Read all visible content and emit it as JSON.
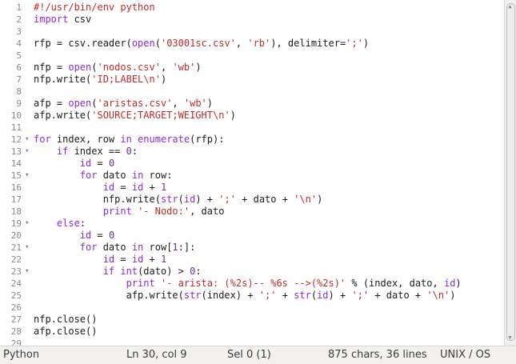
{
  "editor": {
    "lines": [
      {
        "n": "1",
        "fold": "",
        "html": "<span class=\"st\">#!/usr/bin/env python</span>"
      },
      {
        "n": "2",
        "fold": "",
        "html": "<span class=\"kw\">import</span> csv"
      },
      {
        "n": "3",
        "fold": "",
        "html": ""
      },
      {
        "n": "4",
        "fold": "",
        "html": "rfp = csv.reader(<span class=\"kw\">open</span>(<span class=\"st\">'03001sc.csv'</span>, <span class=\"st\">'rb'</span>), delimiter=<span class=\"st\">';'</span>)"
      },
      {
        "n": "5",
        "fold": "",
        "html": ""
      },
      {
        "n": "6",
        "fold": "",
        "html": "nfp = <span class=\"kw\">open</span>(<span class=\"st\">'nodos.csv'</span>, <span class=\"st\">'wb'</span>)"
      },
      {
        "n": "7",
        "fold": "",
        "html": "nfp.write(<span class=\"st\">'ID;LABEL\\n'</span>)"
      },
      {
        "n": "8",
        "fold": "",
        "html": ""
      },
      {
        "n": "9",
        "fold": "",
        "html": "afp = <span class=\"kw\">open</span>(<span class=\"st\">'aristas.csv'</span>, <span class=\"st\">'wb'</span>)"
      },
      {
        "n": "10",
        "fold": "",
        "html": "afp.write(<span class=\"st\">'SOURCE;TARGET;WEIGHT\\n'</span>)"
      },
      {
        "n": "11",
        "fold": "",
        "html": ""
      },
      {
        "n": "12",
        "fold": "▾",
        "html": "<span class=\"kw\">for</span> index, row <span class=\"kw\">in</span> <span class=\"kw\">enumerate</span>(rfp):"
      },
      {
        "n": "13",
        "fold": "▾",
        "html": "    <span class=\"kw\">if</span> index == <span class=\"nu\">0</span>:"
      },
      {
        "n": "14",
        "fold": "",
        "html": "        <span class=\"kw\">id</span> = <span class=\"nu\">0</span>"
      },
      {
        "n": "15",
        "fold": "▾",
        "html": "        <span class=\"kw\">for</span> dato <span class=\"kw\">in</span> row:"
      },
      {
        "n": "16",
        "fold": "",
        "html": "            <span class=\"kw\">id</span> = <span class=\"kw\">id</span> + <span class=\"nu\">1</span>"
      },
      {
        "n": "17",
        "fold": "",
        "html": "            nfp.write(<span class=\"kw\">str</span>(<span class=\"kw\">id</span>) + <span class=\"st\">';'</span> + dato + <span class=\"st\">'\\n'</span>)"
      },
      {
        "n": "18",
        "fold": "",
        "html": "            <span class=\"kw\">print</span> <span class=\"st\">'- Nodo:'</span>, dato"
      },
      {
        "n": "19",
        "fold": "▾",
        "html": "    <span class=\"kw\">else</span>:"
      },
      {
        "n": "20",
        "fold": "",
        "html": "        <span class=\"kw\">id</span> = <span class=\"nu\">0</span>"
      },
      {
        "n": "21",
        "fold": "▾",
        "html": "        <span class=\"kw\">for</span> dato <span class=\"kw\">in</span> row[<span class=\"nu\">1</span>:]:"
      },
      {
        "n": "22",
        "fold": "",
        "html": "            <span class=\"kw\">id</span> = <span class=\"kw\">id</span> + <span class=\"nu\">1</span>"
      },
      {
        "n": "23",
        "fold": "▾",
        "html": "            <span class=\"kw\">if</span> <span class=\"kw\">int</span>(dato) > <span class=\"nu\">0</span>:"
      },
      {
        "n": "24",
        "fold": "",
        "html": "                <span class=\"kw\">print</span> <span class=\"st\">'- arista: (%2s)-- %6s -->(%2s)'</span> % (index, dato, <span class=\"kw\">id</span>)"
      },
      {
        "n": "25",
        "fold": "",
        "html": "                afp.write(<span class=\"kw\">str</span>(index) + <span class=\"st\">';'</span> + <span class=\"kw\">str</span>(<span class=\"kw\">id</span>) + <span class=\"st\">';'</span> + dato + <span class=\"st\">'\\n'</span>)"
      },
      {
        "n": "26",
        "fold": "",
        "html": ""
      },
      {
        "n": "27",
        "fold": "",
        "html": "nfp.close()"
      },
      {
        "n": "28",
        "fold": "",
        "html": "afp.close()"
      },
      {
        "n": "29",
        "fold": "",
        "html": ""
      }
    ]
  },
  "status": {
    "language": "Python",
    "position": "Ln 30, col 9",
    "selection": "Sel 0 (1)",
    "counts": "875 chars, 36 lines",
    "eol": "UNIX / OS"
  },
  "colors": {
    "keyword": "#8a2be2",
    "string": "#c02b2b",
    "number": "#6a2fb0",
    "linenum": "#8a8a8a"
  }
}
